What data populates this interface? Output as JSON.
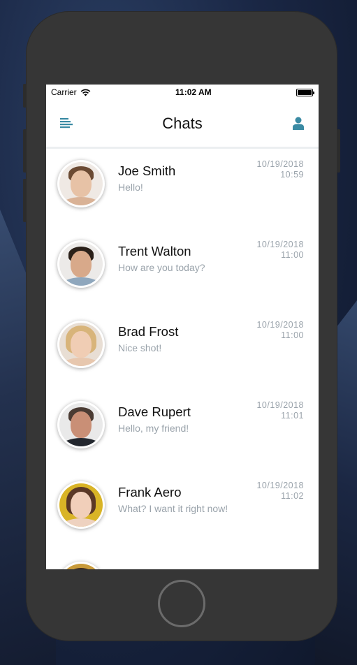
{
  "status_bar": {
    "carrier": "Carrier",
    "time": "11:02 AM"
  },
  "header": {
    "title": "Chats",
    "menu_icon": "menu-lines-icon",
    "profile_icon": "user-icon",
    "accent_color": "#3a8aa3"
  },
  "chats": [
    {
      "name": "Joe Smith",
      "message": "Hello!",
      "date": "10/19/2018",
      "time": "10:59"
    },
    {
      "name": "Trent Walton",
      "message": "How are you today?",
      "date": "10/19/2018",
      "time": "11:00"
    },
    {
      "name": "Brad Frost",
      "message": "Nice shot!",
      "date": "10/19/2018",
      "time": "11:00"
    },
    {
      "name": "Dave Rupert",
      "message": "Hello, my friend!",
      "date": "10/19/2018",
      "time": "11:01"
    },
    {
      "name": "Frank Aero",
      "message": "What? I want it right now!",
      "date": "10/19/2018",
      "time": "11:02"
    },
    {
      "name": "",
      "message": "",
      "date": "",
      "time": ""
    }
  ]
}
